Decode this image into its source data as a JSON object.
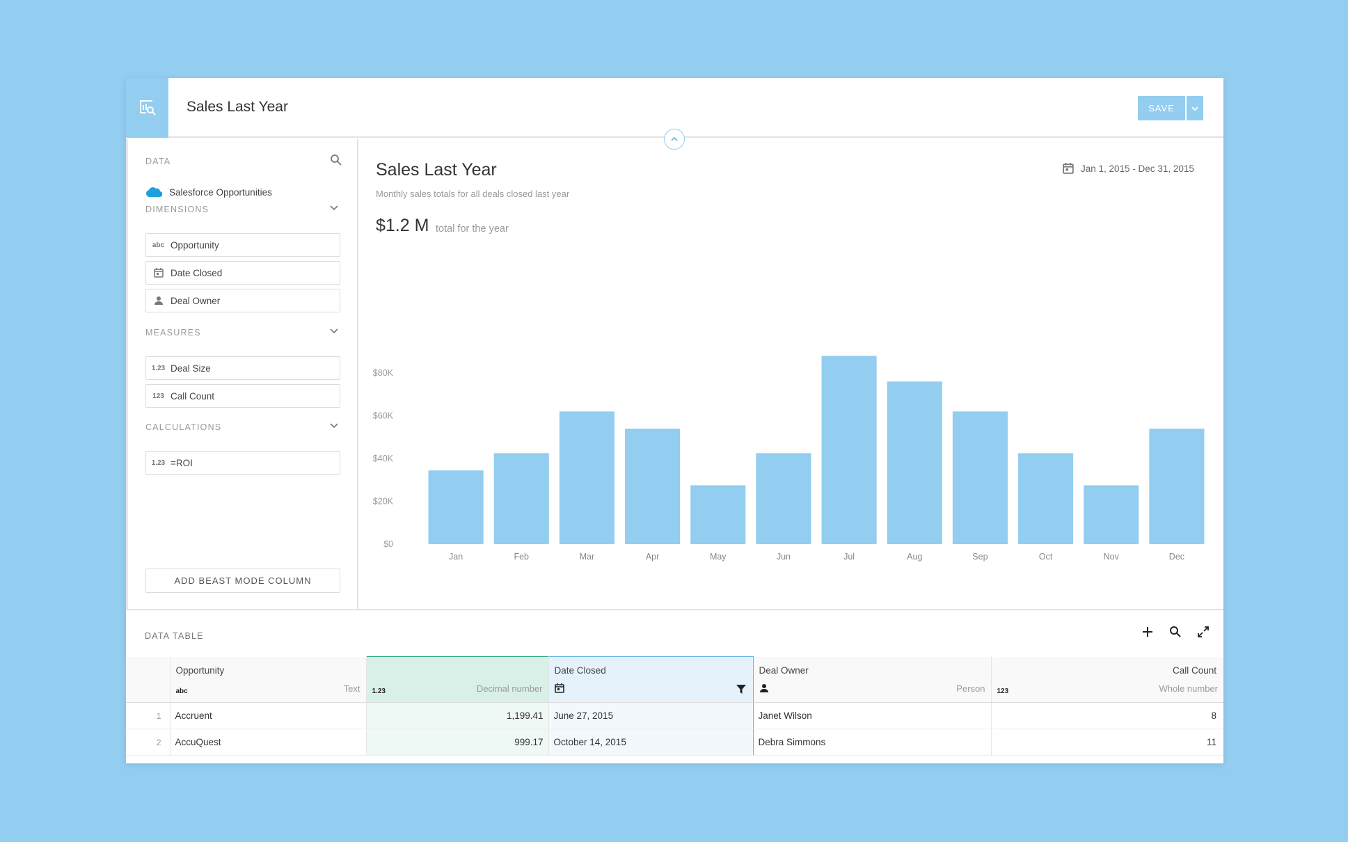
{
  "header": {
    "title": "Sales Last Year",
    "save_label": "SAVE"
  },
  "left_panel": {
    "data_label": "DATA",
    "source": "Salesforce Opportunities",
    "dimensions_label": "DIMENSIONS",
    "dimensions": [
      {
        "icon": "abc",
        "label": "Opportunity"
      },
      {
        "icon": "calendar-icon",
        "label": "Date Closed"
      },
      {
        "icon": "person-icon",
        "label": "Deal Owner"
      }
    ],
    "measures_label": "MEASURES",
    "measures": [
      {
        "icon": "1.23",
        "label": "Deal Size"
      },
      {
        "icon": "123",
        "label": "Call Count"
      }
    ],
    "calculations_label": "CALCULATIONS",
    "calculations": [
      {
        "icon": "1.23",
        "label": "=ROI"
      }
    ],
    "add_button_label": "ADD BEAST MODE COLUMN"
  },
  "chart_panel": {
    "title": "Sales Last Year",
    "subtitle": "Monthly sales totals for all deals closed last year",
    "total_value": "$1.2 M",
    "total_label": "total for the year",
    "date_range": "Jan 1, 2015 - Dec 31, 2015"
  },
  "chart_data": {
    "type": "bar",
    "categories": [
      "Jan",
      "Feb",
      "Mar",
      "Apr",
      "May",
      "Jun",
      "Jul",
      "Aug",
      "Sep",
      "Oct",
      "Nov",
      "Dec"
    ],
    "values": [
      34500,
      42500,
      62000,
      54000,
      27500,
      42500,
      88000,
      76000,
      62000,
      42500,
      27500,
      54000
    ],
    "ylim": [
      0,
      88000
    ],
    "yticks": [
      0,
      20000,
      40000,
      60000,
      80000
    ],
    "ytick_labels": [
      "$0",
      "$20K",
      "$40K",
      "$60K",
      "$80K"
    ],
    "grid": false,
    "bar_color": "#93cdf0"
  },
  "data_table": {
    "title": "DATA TABLE",
    "columns": [
      {
        "name": "Opportunity",
        "type_icon": "abc",
        "type": "Text"
      },
      {
        "name": "",
        "type_icon": "1.23",
        "type": "Decimal number"
      },
      {
        "name": "Date Closed",
        "type_icon": "calendar-icon",
        "type": ""
      },
      {
        "name": "Deal Owner",
        "type_icon": "person-icon",
        "type": "Person"
      },
      {
        "name": "Call Count",
        "type_icon": "123",
        "type": "Whole number"
      }
    ],
    "rows": [
      {
        "num": "1",
        "opportunity": "Accruent",
        "deal_size": "1,199.41",
        "date_closed": "June 27, 2015",
        "owner": "Janet Wilson",
        "calls": "8"
      },
      {
        "num": "2",
        "opportunity": "AccuQuest",
        "deal_size": "999.17",
        "date_closed": "October 14, 2015",
        "owner": "Debra Simmons",
        "calls": "11"
      }
    ]
  },
  "colors": {
    "background": "#93cdf0",
    "accent": "#93cdf0",
    "deal_size_highlight": "#2eaa86",
    "date_closed_highlight": "#64b6e8"
  }
}
